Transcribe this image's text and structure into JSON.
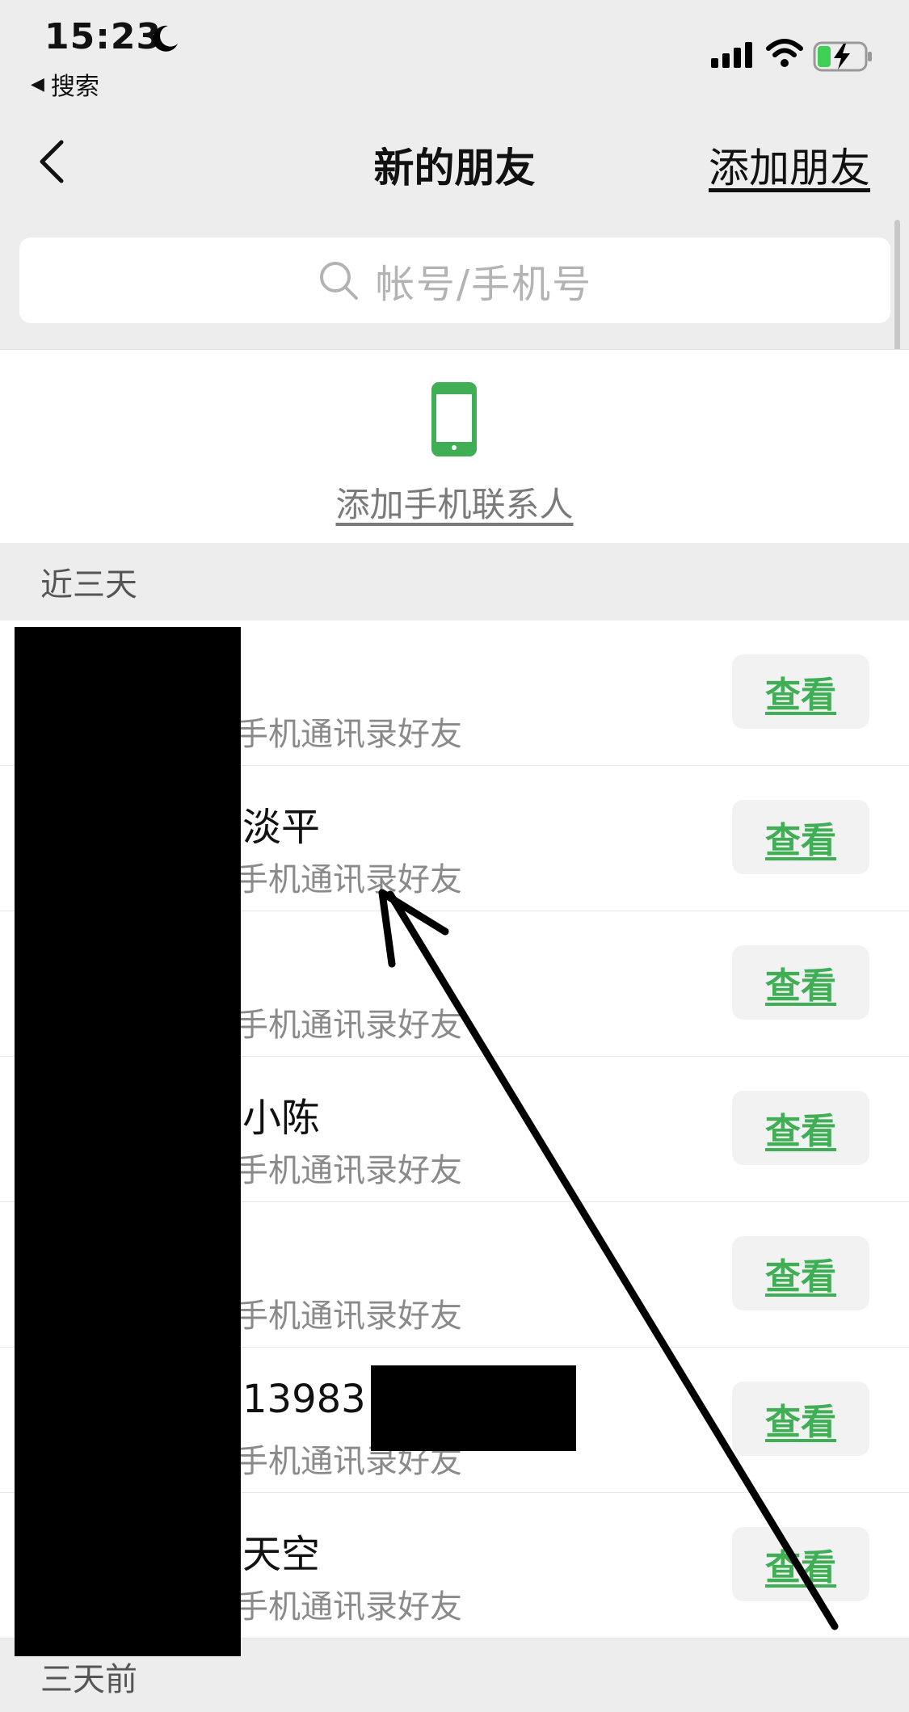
{
  "status_bar": {
    "time": "15:23",
    "back_app_label": "搜索",
    "icons": [
      "moon-icon",
      "signal-icon",
      "wifi-icon",
      "battery-charging-icon"
    ]
  },
  "nav": {
    "title": "新的朋友",
    "action": "添加朋友",
    "back_icon": "chevron-left-icon"
  },
  "search": {
    "placeholder": "帐号/手机号",
    "icon": "search-icon"
  },
  "add_contacts": {
    "label": "添加手机联系人",
    "icon": "mobile-phone-icon",
    "icon_color": "#3fae55"
  },
  "sections": {
    "recent": "近三天",
    "older": "三天前"
  },
  "requests": [
    {
      "name": "",
      "subtitle": "手机通讯录好友",
      "button": "查看"
    },
    {
      "name": "淡平",
      "subtitle": "手机通讯录好友",
      "button": "查看"
    },
    {
      "name": "",
      "subtitle": "手机通讯录好友",
      "button": "查看"
    },
    {
      "name": "小陈",
      "subtitle": "手机通讯录好友",
      "button": "查看"
    },
    {
      "name": "",
      "subtitle": "手机通讯录好友",
      "button": "查看"
    },
    {
      "name": "13983",
      "subtitle": "手机通讯录好友",
      "button": "查看"
    },
    {
      "name": "天空",
      "subtitle": "手机通讯录好友",
      "button": "查看"
    }
  ],
  "colors": {
    "accent_green": "#3fae55",
    "background": "#ededed"
  }
}
